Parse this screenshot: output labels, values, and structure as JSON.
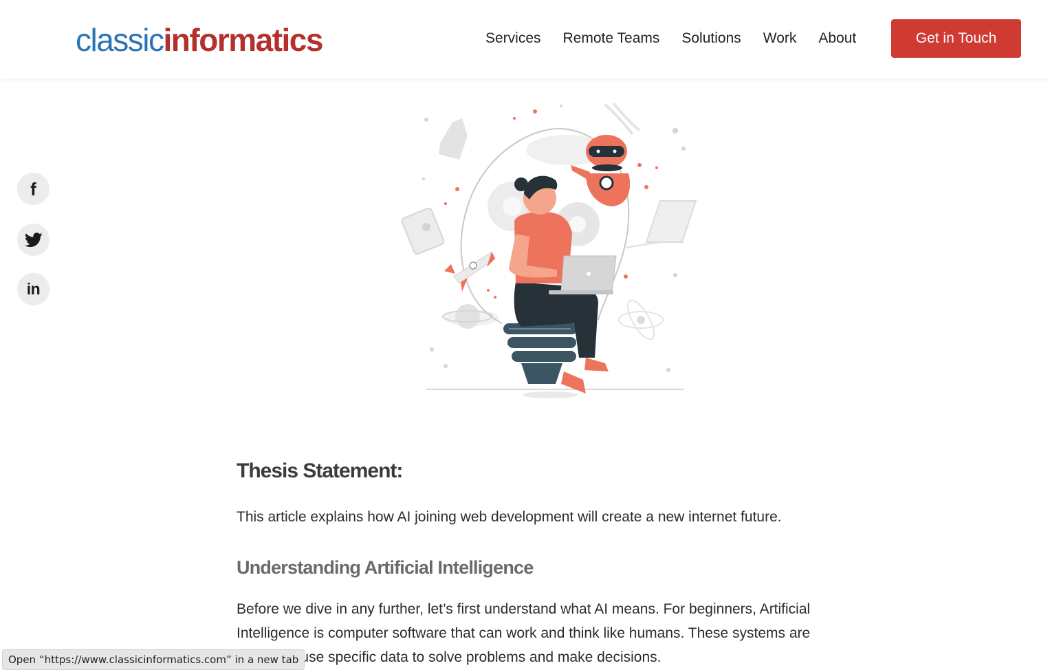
{
  "logo": {
    "part1": "classic",
    "part2": "informatics"
  },
  "nav": {
    "items": [
      "Services",
      "Remote Teams",
      "Solutions",
      "Work",
      "About"
    ],
    "cta": "Get in Touch"
  },
  "social": {
    "facebook_glyph": "f",
    "linkedin_glyph": "in"
  },
  "article": {
    "thesis_heading": "Thesis Statement:",
    "thesis_text": "This article explains how AI joining web development will create a new internet future.",
    "section_heading": "Understanding Artificial Intelligence",
    "body_text": "Before we dive in any further, let’s first understand what AI means. For beginners, Artificial Intelligence is computer software that can work and think like humans. These systems are trained to use specific data to solve problems and make decisions."
  },
  "status_bar": {
    "text": "Open “https://www.classicinformatics.com” in a new tab"
  },
  "colors": {
    "brand_blue": "#2a73b6",
    "brand_red": "#b5302d",
    "cta_red": "#cf3a33",
    "illustration_coral": "#ee735d",
    "illustration_dark": "#263238"
  },
  "icons": [
    "facebook-icon",
    "twitter-icon",
    "linkedin-icon"
  ]
}
